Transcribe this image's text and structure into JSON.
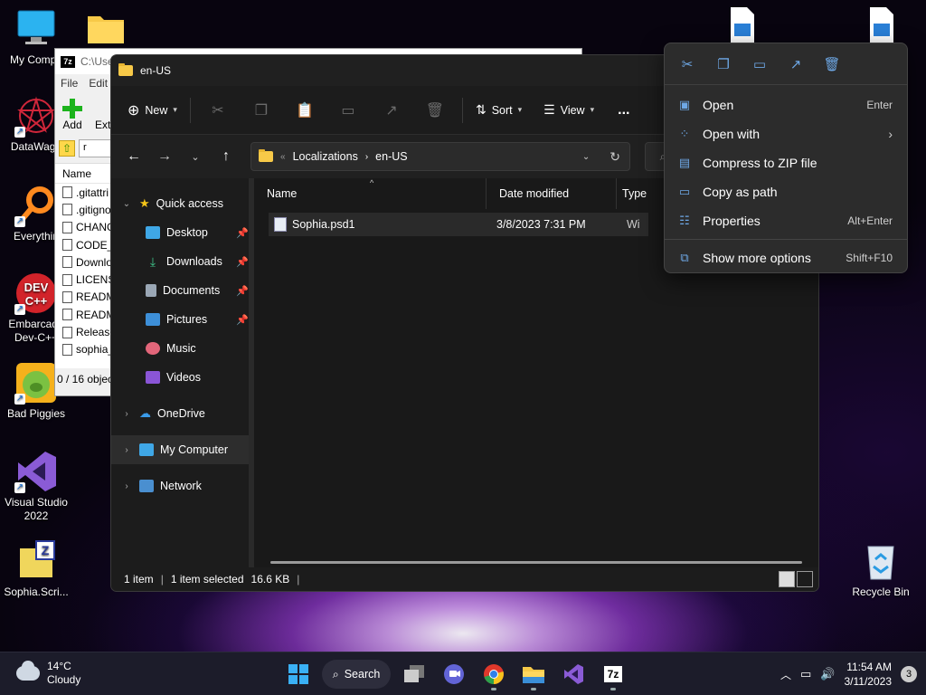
{
  "desktop": {
    "icons": [
      {
        "label": "My Compu"
      },
      {
        "label": "DataWago"
      },
      {
        "label": "Everythin"
      },
      {
        "label": "Embarcade Dev-C++"
      },
      {
        "label": "Bad Piggies"
      },
      {
        "label": "Visual Studio 2022"
      },
      {
        "label": "Sophia.Scri..."
      },
      {
        "label": "Recycle Bin"
      }
    ]
  },
  "sevenzip": {
    "title": "C:\\Use",
    "menu": [
      "File",
      "Edit"
    ],
    "toolbar": {
      "add": "Add",
      "extract": "Ext"
    },
    "address": "r",
    "column_name": "Name",
    "files": [
      ".gitattri",
      ".gitigno",
      "CHANG",
      "CODE_",
      "Downlo",
      "LICENS",
      "READM",
      "READM",
      "Release",
      "sophia_"
    ],
    "status": "0 / 16 objec"
  },
  "explorer": {
    "title": "en-US",
    "commands": {
      "new": "New",
      "sort": "Sort",
      "view": "View",
      "more": "..."
    },
    "breadcrumb": {
      "root": "Localizations",
      "current": "en-US"
    },
    "sidebar": {
      "quick_access": "Quick access",
      "items": [
        {
          "label": "Desktop"
        },
        {
          "label": "Downloads"
        },
        {
          "label": "Documents"
        },
        {
          "label": "Pictures"
        },
        {
          "label": "Music"
        },
        {
          "label": "Videos"
        }
      ],
      "onedrive": "OneDrive",
      "my_computer": "My Computer",
      "network": "Network"
    },
    "columns": {
      "name": "Name",
      "date": "Date modified",
      "type": "Type"
    },
    "file": {
      "name": "Sophia.psd1",
      "date": "3/8/2023 7:31 PM",
      "type": "Wi"
    },
    "status": {
      "count": "1 item",
      "selected": "1 item selected",
      "size": "16.6 KB"
    }
  },
  "context_menu": {
    "items": [
      {
        "label": "Open",
        "shortcut": "Enter"
      },
      {
        "label": "Open with",
        "shortcut": ""
      },
      {
        "label": "Compress to ZIP file",
        "shortcut": ""
      },
      {
        "label": "Copy as path",
        "shortcut": ""
      },
      {
        "label": "Properties",
        "shortcut": "Alt+Enter"
      }
    ],
    "more": {
      "label": "Show more options",
      "shortcut": "Shift+F10"
    }
  },
  "taskbar": {
    "weather": {
      "temp": "14°C",
      "condition": "Cloudy"
    },
    "search": "Search",
    "time": "11:54 AM",
    "date": "3/11/2023",
    "notifications": "3"
  }
}
